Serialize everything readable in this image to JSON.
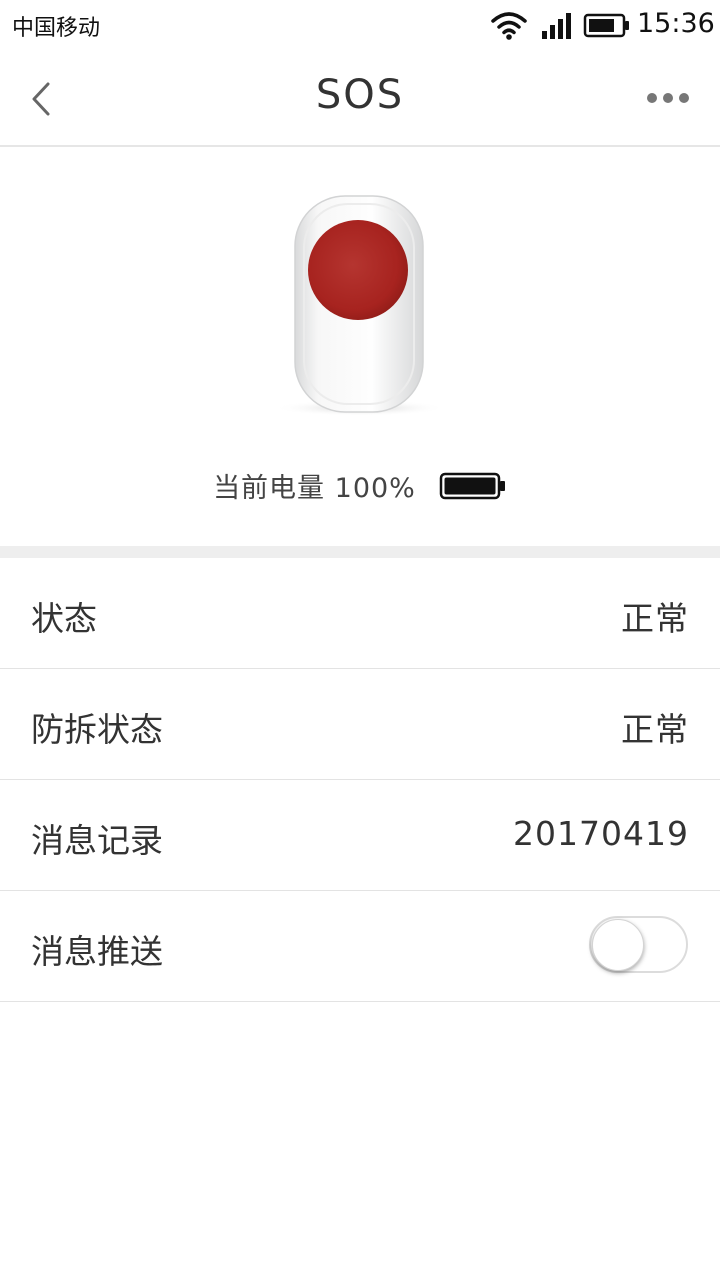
{
  "status_bar": {
    "carrier": "中国移动",
    "time": "15:36",
    "icons": [
      "wifi-icon",
      "cell-signal-icon",
      "battery-icon"
    ]
  },
  "nav": {
    "title": "SOS",
    "back_icon": "chevron-left-icon",
    "more_icon": "more-horizontal-icon"
  },
  "device": {
    "image": "sos-button-device",
    "accent_color": "#b22c27",
    "battery_label": "当前电量 100%",
    "battery_level": 1.0
  },
  "rows": [
    {
      "label": "状态",
      "value": "正常"
    },
    {
      "label": "防拆状态",
      "value": "正常"
    },
    {
      "label": "消息记录",
      "value": "20170419"
    },
    {
      "label": "消息推送",
      "toggle_on": false
    }
  ]
}
